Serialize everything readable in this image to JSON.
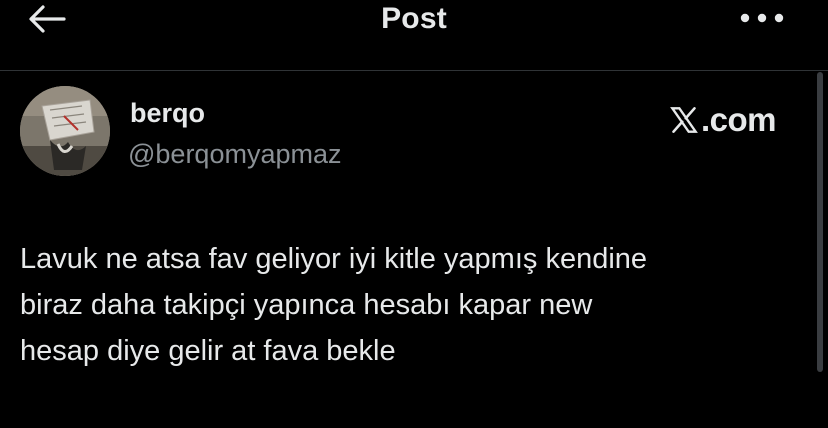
{
  "header": {
    "title": "Post",
    "back_icon": "arrow-left-icon",
    "more_icon": "more-horizontal-icon"
  },
  "author": {
    "display_name": "berqo",
    "handle": "@berqomyapmaz"
  },
  "source": {
    "logo_icon": "x-logo-icon",
    "label": ".com"
  },
  "tweet": {
    "lines": [
      "Lavuk ne atsa fav geliyor iyi kitle yapmış kendine",
      "biraz daha takipçi yapınca hesabı kapar new",
      "hesap diye gelir at fava bekle"
    ]
  },
  "colors": {
    "background": "#000000",
    "text": "#e7e9ea",
    "secondary_text": "#8b9196",
    "divider": "#2f3336"
  }
}
